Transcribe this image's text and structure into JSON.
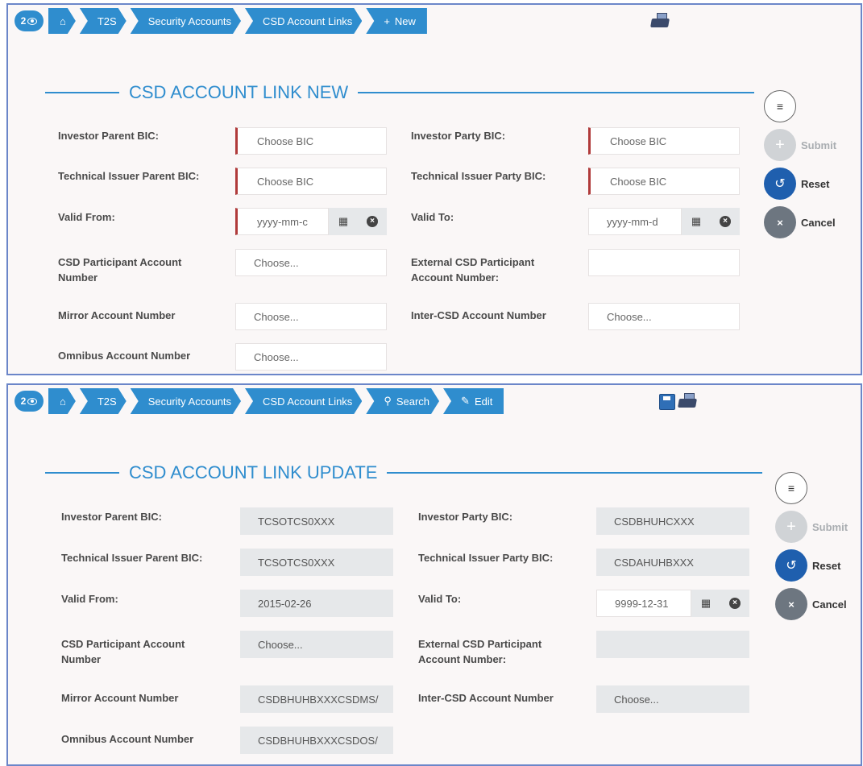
{
  "colors": {
    "accent": "#2f8dce",
    "required": "#b03a3a",
    "readonly": "#e6e8ea",
    "reset": "#1f5fae",
    "cancel": "#6d7680"
  },
  "new_screen": {
    "breadcrumb": {
      "badge": "2",
      "home_icon": "home-icon",
      "items": [
        "T2S",
        "Security Accounts",
        "CSD Account Links",
        "New"
      ]
    },
    "title": "CSD ACCOUNT LINK NEW",
    "labels": {
      "investor_parent_bic": "Investor Parent BIC:",
      "investor_party_bic": "Investor Party BIC:",
      "tech_issuer_parent_bic": "Technical Issuer Parent BIC:",
      "tech_issuer_party_bic": "Technical Issuer Party BIC:",
      "valid_from": "Valid From:",
      "valid_to": "Valid To:",
      "csd_participant_account_l1": "CSD Participant Account",
      "csd_participant_account_l2": "Number",
      "external_csd_participant_l1": "External CSD Participant",
      "external_csd_participant_l2": "Account Number:",
      "mirror_account": "Mirror Account Number",
      "inter_csd_account": "Inter-CSD Account Number",
      "omnibus_account": "Omnibus Account Number"
    },
    "values": {
      "investor_parent_bic": "Choose BIC",
      "investor_party_bic": "Choose BIC",
      "tech_issuer_parent_bic": "Choose BIC",
      "tech_issuer_party_bic": "Choose BIC",
      "valid_from": "yyyy-mm-c",
      "valid_to": "yyyy-mm-d",
      "csd_participant_account": "Choose...",
      "external_csd_participant": "",
      "mirror_account": "Choose...",
      "inter_csd_account": "Choose...",
      "omnibus_account": "Choose..."
    },
    "buttons": {
      "submit": "Submit",
      "reset": "Reset",
      "cancel": "Cancel"
    }
  },
  "update_screen": {
    "breadcrumb": {
      "badge": "2",
      "home_icon": "home-icon",
      "items": [
        "T2S",
        "Security Accounts",
        "CSD Account Links",
        "Search",
        "Edit"
      ]
    },
    "title": "CSD ACCOUNT LINK UPDATE",
    "labels": {
      "investor_parent_bic": "Investor Parent BIC:",
      "investor_party_bic": "Investor Party BIC:",
      "tech_issuer_parent_bic": "Technical Issuer Parent BIC:",
      "tech_issuer_party_bic": "Technical Issuer Party BIC:",
      "valid_from": "Valid From:",
      "valid_to": "Valid To:",
      "csd_participant_account_l1": "CSD Participant Account",
      "csd_participant_account_l2": "Number",
      "external_csd_participant_l1": "External CSD Participant",
      "external_csd_participant_l2": "Account Number:",
      "mirror_account": "Mirror Account Number",
      "inter_csd_account": "Inter-CSD Account Number",
      "omnibus_account": "Omnibus Account Number"
    },
    "values": {
      "investor_parent_bic": "TCSOTCS0XXX",
      "investor_party_bic": "CSDBHUHCXXX",
      "tech_issuer_parent_bic": "TCSOTCS0XXX",
      "tech_issuer_party_bic": "CSDAHUHBXXX",
      "valid_from": "2015-02-26",
      "valid_to": "9999-12-31",
      "csd_participant_account": "Choose...",
      "external_csd_participant": "",
      "mirror_account": "CSDBHUHBXXXCSDMS/",
      "inter_csd_account": "Choose...",
      "omnibus_account": "CSDBHUHBXXXCSDOS/"
    },
    "buttons": {
      "submit": "Submit",
      "reset": "Reset",
      "cancel": "Cancel"
    }
  }
}
